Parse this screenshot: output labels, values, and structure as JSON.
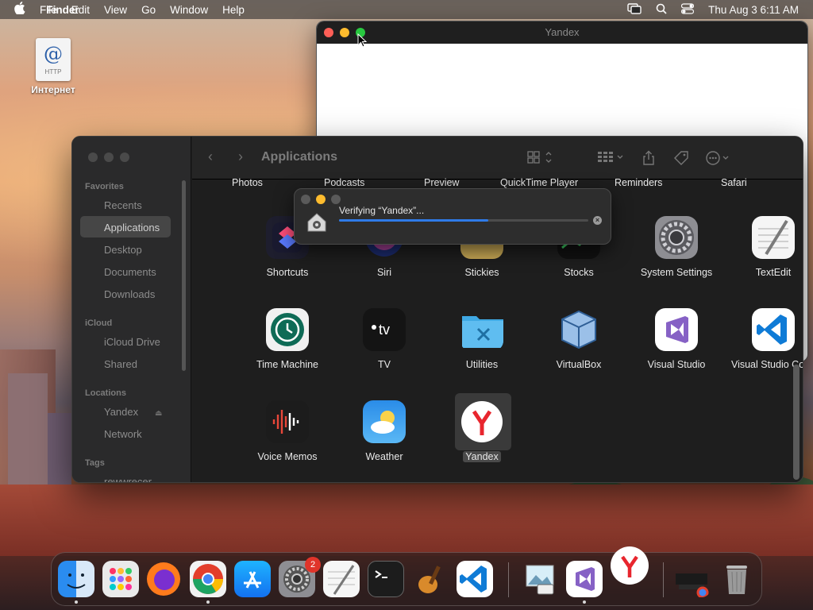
{
  "menubar": {
    "app_name": "Finder",
    "items": [
      "File",
      "Edit",
      "View",
      "Go",
      "Window",
      "Help"
    ],
    "clock": "Thu Aug 3  6:11 AM"
  },
  "desktop": {
    "icon_label": "Интернет",
    "icon_badge": "@",
    "icon_sub": "HTTP"
  },
  "yandex_window": {
    "title": "Yandex"
  },
  "finder": {
    "title": "Applications",
    "sidebar": {
      "favorites_header": "Favorites",
      "favorites": [
        "Recents",
        "Applications",
        "Desktop",
        "Documents",
        "Downloads"
      ],
      "icloud_header": "iCloud",
      "icloud": [
        "iCloud Drive",
        "Shared"
      ],
      "locations_header": "Locations",
      "locations": [
        "Yandex",
        "Network"
      ],
      "tags_header": "Tags",
      "tags": [
        "rewwrecer"
      ]
    },
    "top_row": [
      "Photos",
      "Podcasts",
      "Preview",
      "QuickTime Player",
      "Reminders",
      "Safari"
    ],
    "row1": [
      "Shortcuts",
      "Siri",
      "Stickies",
      "Stocks",
      "System Settings",
      "TextEdit"
    ],
    "row2": [
      "Time Machine",
      "TV",
      "Utilities",
      "VirtualBox",
      "Visual Studio",
      "Visual Studio Code"
    ],
    "row3": [
      "Voice Memos",
      "Weather",
      "Yandex"
    ],
    "selected_app": "Yandex"
  },
  "verify_dialog": {
    "text": "Verifying “Yandex”...",
    "progress": 0.6
  },
  "dock": {
    "apps": [
      "Finder",
      "Launchpad",
      "Firefox",
      "Chrome",
      "App Store",
      "System Settings",
      "TextEdit",
      "Terminal",
      "GarageBand",
      "Visual Studio Code",
      "Preview",
      "Visual Studio",
      "Yandex",
      "Downloads",
      "Trash"
    ],
    "settings_badge": "2"
  },
  "icons": {
    "apple": "apple-logo-icon",
    "control_center": "control-center-icon",
    "search": "search-icon"
  },
  "colors": {
    "accent_blue": "#2f7be8",
    "close_red": "#ff5f57",
    "min_yellow": "#febc2e",
    "zoom_green": "#28c840",
    "yandex_red": "#e8262e"
  }
}
